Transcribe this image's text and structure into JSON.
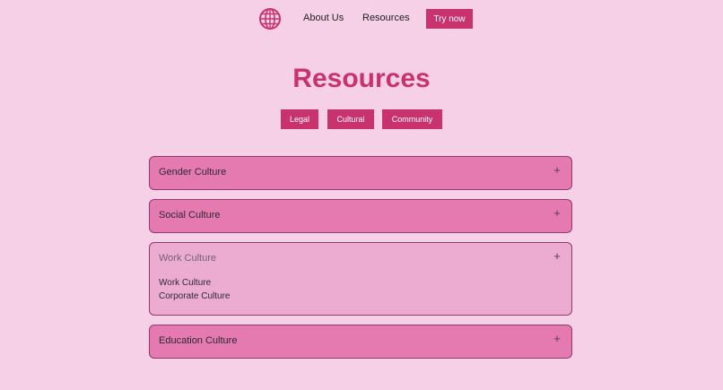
{
  "nav": {
    "logo_icon": "globe-icon",
    "links": [
      "About Us",
      "Resources"
    ],
    "cta_label": "Try now"
  },
  "page_title": "Resources",
  "filters": [
    "Legal",
    "Cultural",
    "Community"
  ],
  "accordion": [
    {
      "title": "Gender Culture",
      "expanded": false,
      "toggle": "+"
    },
    {
      "title": "Social Culture",
      "expanded": false,
      "toggle": "+"
    },
    {
      "title": "Work Culture",
      "expanded": true,
      "toggle": "+",
      "items": [
        "Work Culture",
        "Corporate Culture"
      ]
    },
    {
      "title": "Education Culture",
      "expanded": false,
      "toggle": "+"
    }
  ],
  "colors": {
    "background": "#f5d0e6",
    "accent": "#c8336f",
    "accordion_collapsed": "#e47ab0",
    "accordion_expanded": "#ecabd1"
  }
}
